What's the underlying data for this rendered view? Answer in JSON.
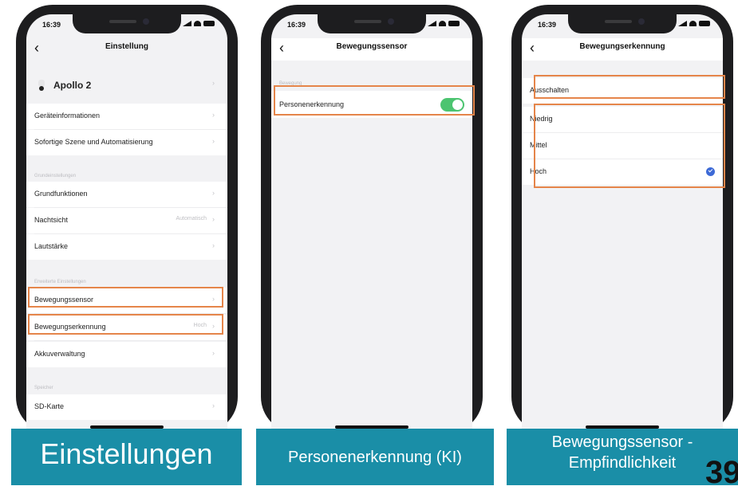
{
  "status_time": "16:39",
  "panel1": {
    "title": "Einstellung",
    "device_name": "Apollo 2",
    "rows_top": [
      "Geräteinformationen",
      "Sofortige Szene und Automatisierung"
    ],
    "section_basic": "Grundeinstellungen",
    "rows_mid": [
      {
        "label": "Grundfunktionen",
        "value": ""
      },
      {
        "label": "Nachtsicht",
        "value": "Automatisch"
      },
      {
        "label": "Lautstärke",
        "value": ""
      }
    ],
    "section_advanced": "Erweiterte Einstellungen",
    "rows_adv": [
      {
        "label": "Bewegungssensor",
        "value": ""
      },
      {
        "label": "Bewegungserkennung",
        "value": "Hoch"
      },
      {
        "label": "Akkuverwaltung",
        "value": ""
      }
    ],
    "section_storage": "Speicher",
    "row_sd": "SD-Karte",
    "caption": "Einstellungen"
  },
  "panel2": {
    "title": "Bewegungssensor",
    "section": "Bewegung",
    "row": "Personenerkennung",
    "toggle_on": true,
    "caption": "Personenerkennung (KI)"
  },
  "panel3": {
    "title": "Bewegungserkennung",
    "off_option": "Ausschalten",
    "levels": [
      "Niedrig",
      "Mittel",
      "Hoch"
    ],
    "selected": "Hoch",
    "caption_line1": "Bewegungssensor -",
    "caption_line2": "Empfindlichkeit"
  },
  "page_number": "39",
  "colors": {
    "highlight": "#e5854a",
    "caption_bg": "#1a8ea7",
    "toggle_on": "#4cc470",
    "check": "#3d6ad6"
  }
}
